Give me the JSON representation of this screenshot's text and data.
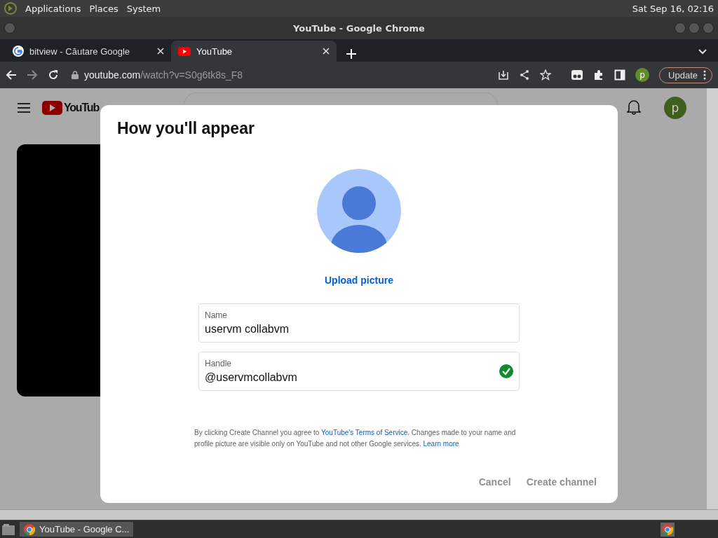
{
  "top_panel": {
    "menus": [
      "Applications",
      "Places",
      "System"
    ],
    "clock": "Sat Sep 16, 02:16"
  },
  "window": {
    "title": "YouTube - Google Chrome"
  },
  "tabs": [
    {
      "label": "bitview - Căutare Google",
      "kind": "google",
      "selected": false
    },
    {
      "label": "YouTube",
      "kind": "youtube",
      "selected": true
    }
  ],
  "address": {
    "host": "youtube.com",
    "path": "/watch?v=S0g6tk8s_F8"
  },
  "toolbar": {
    "profile": "p",
    "update_button": "Update"
  },
  "page": {
    "logo_text": "YouTub",
    "avatar": "p"
  },
  "dialog": {
    "title": "How you'll appear",
    "upload": "Upload picture",
    "fields": [
      {
        "label": "Name",
        "value": "uservm collabvm",
        "valid": false
      },
      {
        "label": "Handle",
        "value": "@uservmcollabvm",
        "valid": true
      }
    ],
    "disclaimer": [
      {
        "kind": "text",
        "text": "By clicking Create Channel you agree to "
      },
      {
        "kind": "link",
        "text": "YouTube's Terms of Service"
      },
      {
        "kind": "text",
        "text": ". Changes made to your name and profile picture are visible only on YouTube and not other Google services. "
      },
      {
        "kind": "link",
        "text": "Learn more"
      }
    ],
    "buttons": [
      {
        "label": "Cancel",
        "disabled": true
      },
      {
        "label": "Create channel",
        "disabled": true
      }
    ]
  },
  "taskbar": {
    "task": "YouTube - Google C..."
  }
}
